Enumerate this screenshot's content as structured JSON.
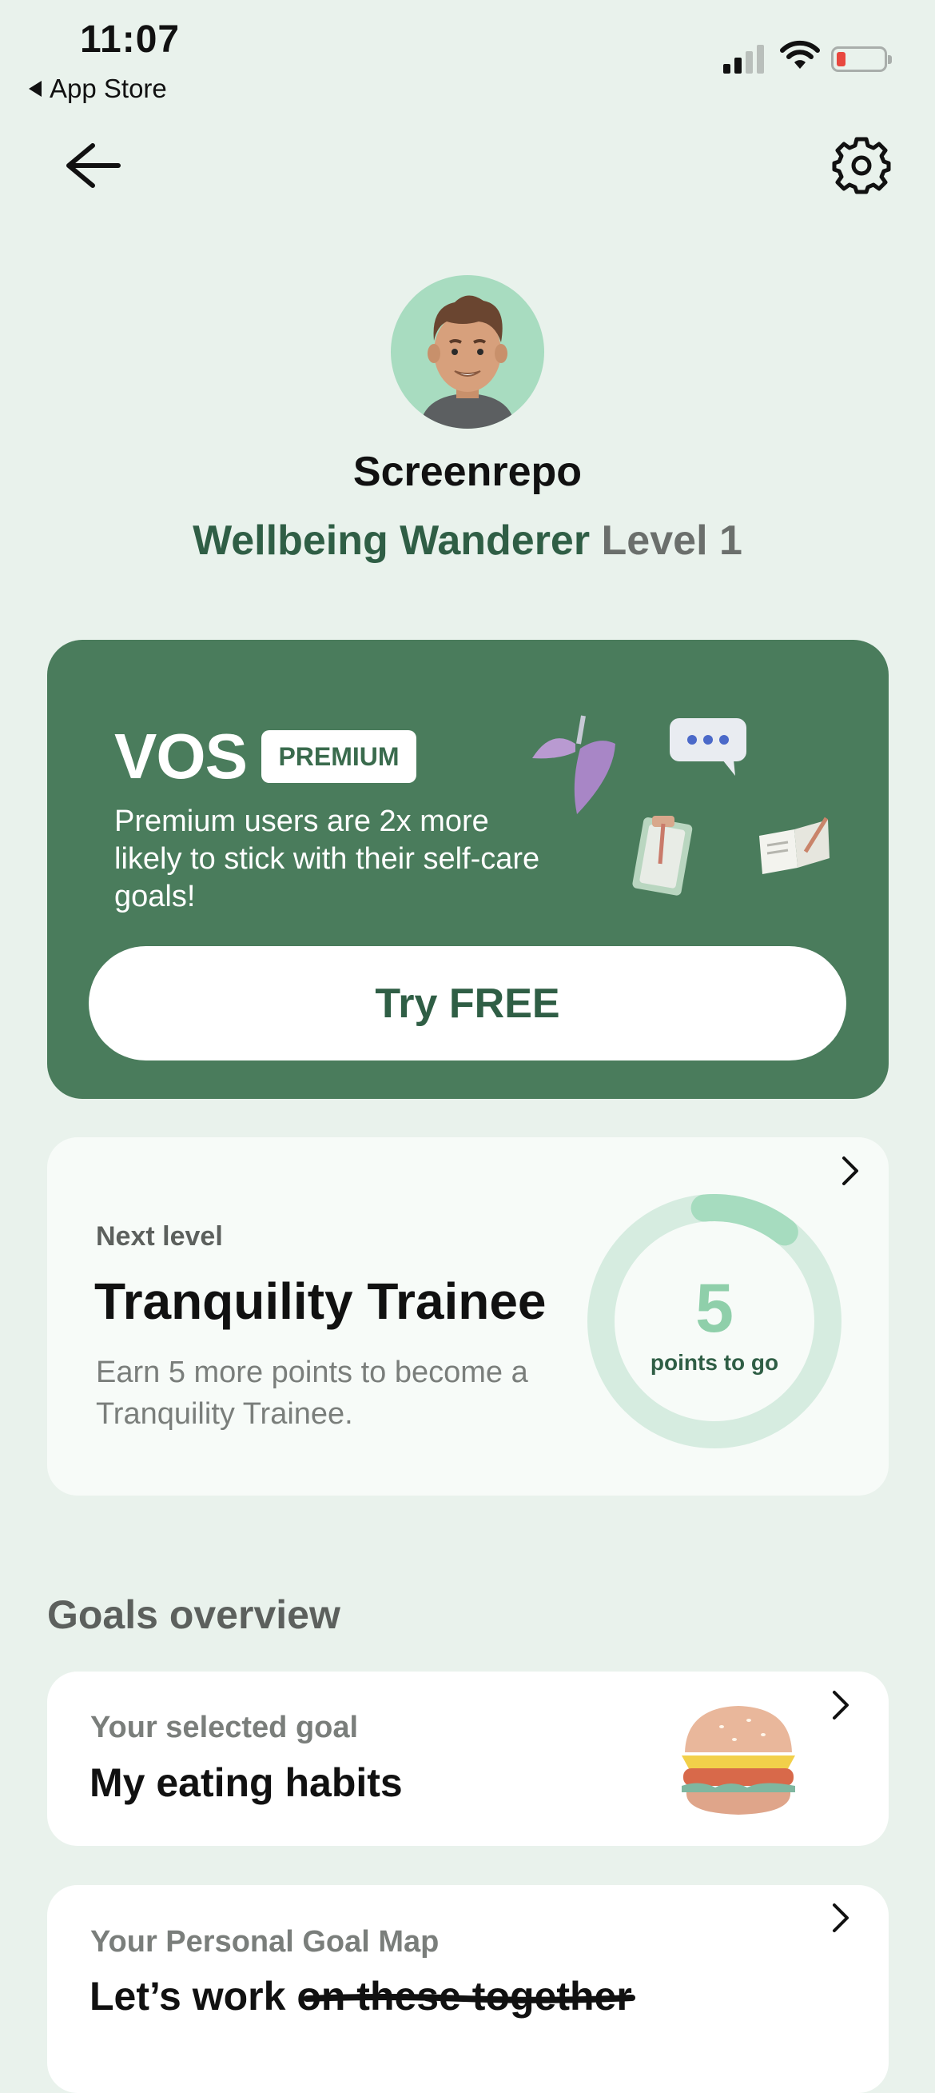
{
  "status_bar": {
    "time": "11:07",
    "back_app": "App Store",
    "battery_color": "#e8483f"
  },
  "nav": {
    "back_icon": "arrow-left-icon",
    "settings_icon": "gear-icon"
  },
  "profile": {
    "username": "Screenrepo",
    "level_title": "Wellbeing Wanderer",
    "level_number": "Level 1"
  },
  "premium": {
    "brand": "VOS",
    "badge": "PREMIUM",
    "text": "Premium users are 2x more likely to stick with their self-care goals!",
    "button_label": "Try FREE",
    "accent_color": "#4a7c5c"
  },
  "next_level": {
    "label": "Next level",
    "title": "Tranquility Trainee",
    "description": "Earn 5 more points to become a Tranquility Trainee.",
    "points": "5",
    "points_caption": "points to go",
    "progress_fraction": 0.12
  },
  "goals": {
    "heading": "Goals overview",
    "selected": {
      "label": "Your selected goal",
      "title": "My eating habits"
    },
    "map": {
      "label": "Your Personal Goal Map",
      "title": "Let’s work on these together"
    }
  }
}
